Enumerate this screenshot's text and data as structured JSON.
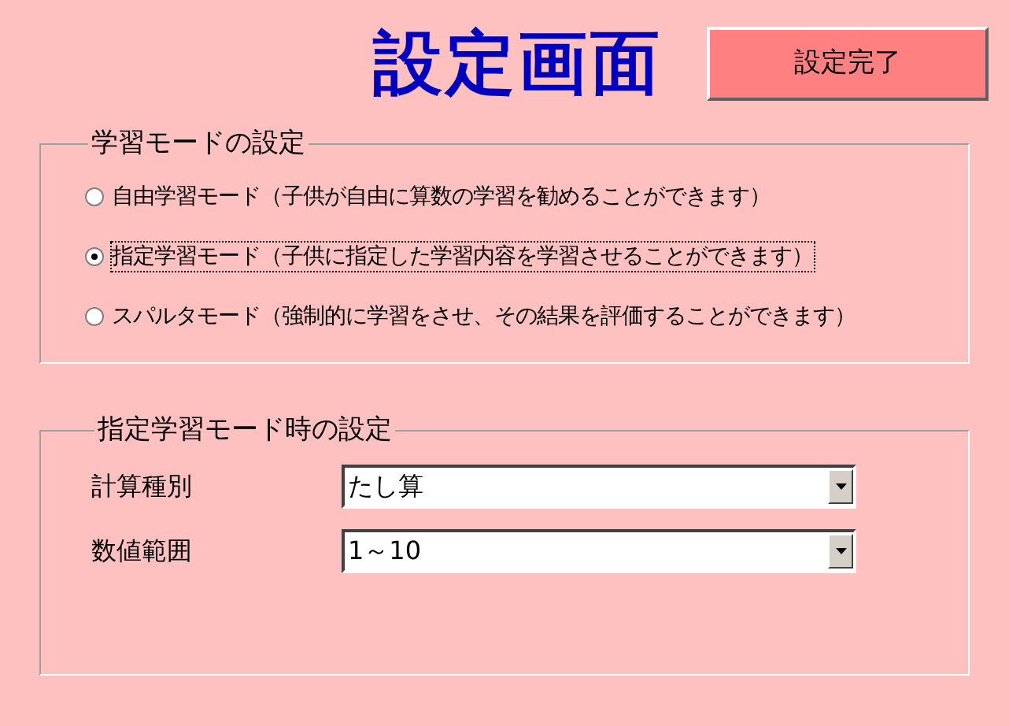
{
  "title": "設定画面",
  "done_button": "設定完了",
  "learning_mode": {
    "legend": "学習モードの設定",
    "options": [
      {
        "label": "自由学習モード（子供が自由に算数の学習を勧めることができます）",
        "selected": false
      },
      {
        "label": "指定学習モード（子供に指定した学習内容を学習させることができます）",
        "selected": true
      },
      {
        "label": "スパルタモード（強制的に学習をさせ、その結果を評価することができます）",
        "selected": false
      }
    ]
  },
  "designated_settings": {
    "legend": "指定学習モード時の設定",
    "fields": [
      {
        "label": "計算種別",
        "value": "たし算"
      },
      {
        "label": "数値範囲",
        "value": "1～10"
      }
    ]
  }
}
